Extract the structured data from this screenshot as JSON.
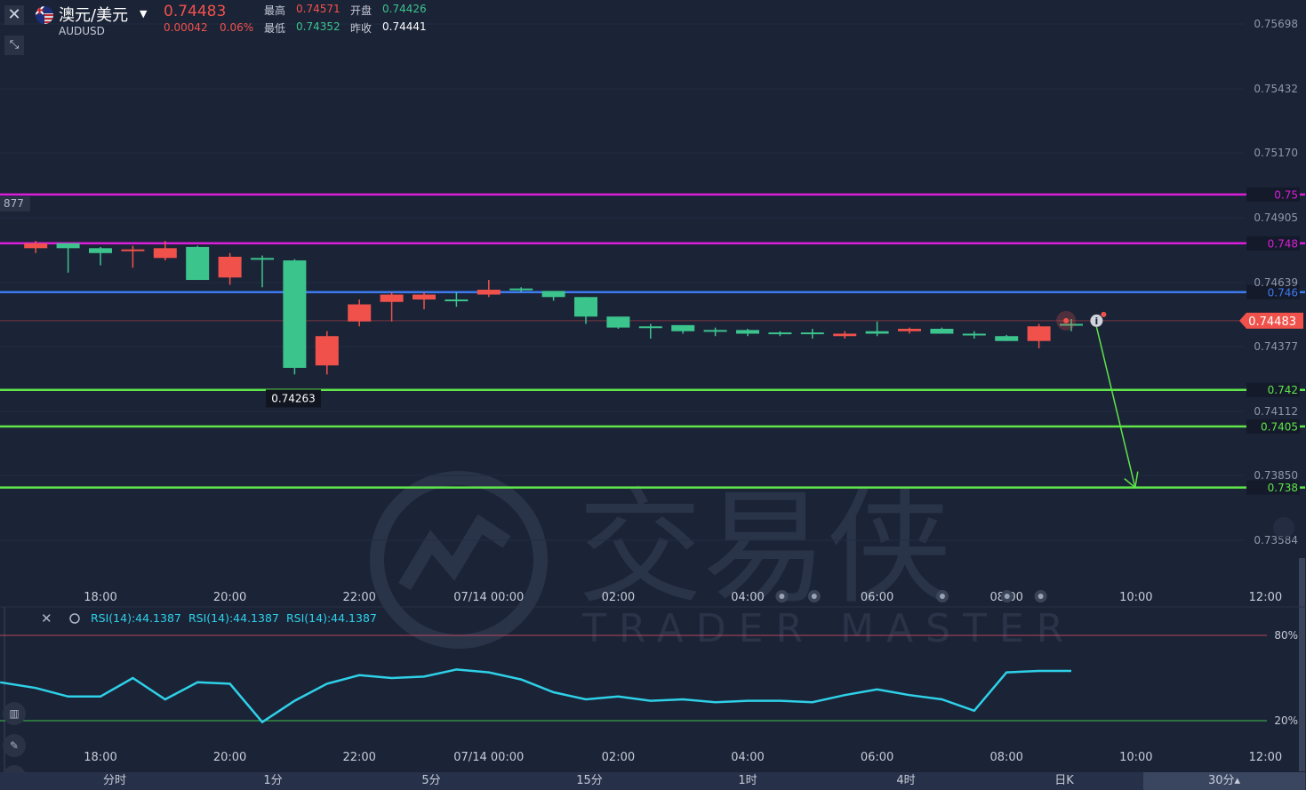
{
  "header": {
    "symbol_name": "澳元/美元",
    "symbol_code": "AUDUSD",
    "last_price": "0.74483",
    "change": "0.00042",
    "change_pct": "0.06%",
    "high_label": "最高",
    "high": "0.74571",
    "open_label": "开盘",
    "open": "0.74426",
    "low_label": "最低",
    "low": "0.74352",
    "prev_close_label": "昨收",
    "prev_close": "0.74441"
  },
  "icons": {
    "close": "close-icon",
    "expand": "expand-icon",
    "flag": "au-us-flag-icon",
    "caret": "caret-down-icon"
  },
  "colors": {
    "background": "#1b2337",
    "up": "#3cc48d",
    "down": "#f0524b",
    "magenta": "#d91fd9",
    "blue": "#3d7bf0",
    "green_line": "#5fe54a",
    "rsi": "#2ed1e8",
    "axis_text": "#8f97a8"
  },
  "chart_data": [
    {
      "type": "candlestick",
      "ylim": [
        0.7345,
        0.7575
      ],
      "y_ticks": [
        "0.75698",
        "0.75432",
        "0.75170",
        "0.74905",
        "0.74639",
        "0.74377",
        "0.74112",
        "0.73850",
        "0.73584"
      ],
      "x_ticks": [
        "18:00",
        "20:00",
        "22:00",
        "07/14 00:00",
        "02:00",
        "04:00",
        "06:00",
        "08:00",
        "10:00",
        "12:00"
      ],
      "x_positions_hours": [
        0,
        2,
        4,
        6,
        8,
        10,
        12,
        14,
        16,
        18
      ],
      "candles": [
        {
          "t": -1.0,
          "o": 0.748,
          "h": 0.7481,
          "l": 0.7476,
          "c": 0.7478
        },
        {
          "t": -0.5,
          "o": 0.7478,
          "h": 0.748,
          "l": 0.7468,
          "c": 0.748
        },
        {
          "t": 0.0,
          "o": 0.7476,
          "h": 0.74785,
          "l": 0.7471,
          "c": 0.7478
        },
        {
          "t": 0.5,
          "o": 0.74775,
          "h": 0.7479,
          "l": 0.747,
          "c": 0.7477
        },
        {
          "t": 1.0,
          "o": 0.7478,
          "h": 0.7481,
          "l": 0.7473,
          "c": 0.7474
        },
        {
          "t": 1.5,
          "o": 0.7465,
          "h": 0.7479,
          "l": 0.7465,
          "c": 0.74785
        },
        {
          "t": 2.0,
          "o": 0.74745,
          "h": 0.7476,
          "l": 0.7463,
          "c": 0.7466
        },
        {
          "t": 2.5,
          "o": 0.7474,
          "h": 0.7475,
          "l": 0.7462,
          "c": 0.7474
        },
        {
          "t": 3.0,
          "o": 0.7429,
          "h": 0.74735,
          "l": 0.74263,
          "c": 0.7473
        },
        {
          "t": 3.5,
          "o": 0.7442,
          "h": 0.7444,
          "l": 0.74263,
          "c": 0.743
        },
        {
          "t": 4.0,
          "o": 0.7455,
          "h": 0.7457,
          "l": 0.7446,
          "c": 0.7448
        },
        {
          "t": 4.5,
          "o": 0.7459,
          "h": 0.746,
          "l": 0.7448,
          "c": 0.7456
        },
        {
          "t": 5.0,
          "o": 0.7459,
          "h": 0.746,
          "l": 0.7453,
          "c": 0.7457
        },
        {
          "t": 5.5,
          "o": 0.7457,
          "h": 0.746,
          "l": 0.7454,
          "c": 0.7457
        },
        {
          "t": 6.0,
          "o": 0.7461,
          "h": 0.7465,
          "l": 0.7458,
          "c": 0.7459
        },
        {
          "t": 6.5,
          "o": 0.7461,
          "h": 0.7462,
          "l": 0.746,
          "c": 0.74615
        },
        {
          "t": 7.0,
          "o": 0.7458,
          "h": 0.74605,
          "l": 0.74565,
          "c": 0.74605
        },
        {
          "t": 7.5,
          "o": 0.745,
          "h": 0.7458,
          "l": 0.7447,
          "c": 0.7458
        },
        {
          "t": 8.0,
          "o": 0.74455,
          "h": 0.745,
          "l": 0.7445,
          "c": 0.745
        },
        {
          "t": 8.5,
          "o": 0.7446,
          "h": 0.7447,
          "l": 0.7441,
          "c": 0.7446
        },
        {
          "t": 9.0,
          "o": 0.7444,
          "h": 0.74465,
          "l": 0.7443,
          "c": 0.74465
        },
        {
          "t": 9.5,
          "o": 0.74445,
          "h": 0.74455,
          "l": 0.7442,
          "c": 0.74445
        },
        {
          "t": 10.0,
          "o": 0.7443,
          "h": 0.7445,
          "l": 0.7442,
          "c": 0.74445
        },
        {
          "t": 10.5,
          "o": 0.74435,
          "h": 0.7444,
          "l": 0.7442,
          "c": 0.74435
        },
        {
          "t": 11.0,
          "o": 0.7443,
          "h": 0.7445,
          "l": 0.7441,
          "c": 0.74435
        },
        {
          "t": 11.5,
          "o": 0.7443,
          "h": 0.7444,
          "l": 0.7441,
          "c": 0.7442
        },
        {
          "t": 12.0,
          "o": 0.7443,
          "h": 0.7448,
          "l": 0.7442,
          "c": 0.7444
        },
        {
          "t": 12.5,
          "o": 0.7445,
          "h": 0.74455,
          "l": 0.7443,
          "c": 0.7444
        },
        {
          "t": 13.0,
          "o": 0.7443,
          "h": 0.74455,
          "l": 0.7443,
          "c": 0.7445
        },
        {
          "t": 13.5,
          "o": 0.74425,
          "h": 0.7444,
          "l": 0.7441,
          "c": 0.7443
        },
        {
          "t": 14.0,
          "o": 0.744,
          "h": 0.74425,
          "l": 0.744,
          "c": 0.7442
        },
        {
          "t": 14.5,
          "o": 0.7446,
          "h": 0.7447,
          "l": 0.7437,
          "c": 0.744
        },
        {
          "t": 15.0,
          "o": 0.7447,
          "h": 0.7449,
          "l": 0.7444,
          "c": 0.7447
        }
      ],
      "current_price": "0.74483",
      "low_label": "0.74263",
      "left_edge_label": "877",
      "horizontal_lines": [
        {
          "price": 0.75,
          "label": "0.75",
          "color": "magenta"
        },
        {
          "price": 0.748,
          "label": "0.748",
          "color": "magenta"
        },
        {
          "price": 0.746,
          "label": "0.746",
          "color": "blue"
        },
        {
          "price": 0.742,
          "label": "0.742",
          "color": "green_line"
        },
        {
          "price": 0.7405,
          "label": "0.7405",
          "color": "green_line"
        },
        {
          "price": 0.738,
          "label": "0.738",
          "color": "green_line"
        }
      ],
      "arrow": {
        "from": {
          "t": 15.5,
          "p": 0.74483
        },
        "to": {
          "t": 16.0,
          "p": 0.738
        }
      }
    },
    {
      "type": "line",
      "title": "RSI(14):44.1387",
      "legend": [
        "RSI(14):44.1387",
        "RSI(14):44.1387",
        "RSI(14):44.1387"
      ],
      "ylim": [
        0,
        100
      ],
      "levels": [
        {
          "value": 80,
          "label": "80%"
        },
        {
          "value": 20,
          "label": "20%"
        }
      ],
      "x_ticks": [
        "18:00",
        "20:00",
        "22:00",
        "07/14 00:00",
        "02:00",
        "04:00",
        "06:00",
        "08:00",
        "10:00",
        "12:00"
      ],
      "x": [
        -1.55,
        -1.0,
        -0.5,
        0.0,
        0.5,
        1.0,
        1.5,
        2.0,
        2.5,
        3.0,
        3.5,
        4.0,
        4.5,
        5.0,
        5.5,
        6.0,
        6.5,
        7.0,
        7.5,
        8.0,
        8.5,
        9.0,
        9.5,
        10.0,
        10.5,
        11.0,
        11.5,
        12.0,
        12.5,
        13.0,
        13.5,
        14.0,
        14.5,
        15.0
      ],
      "values": [
        47,
        43,
        37,
        37,
        50,
        35,
        47,
        46,
        19,
        34,
        46,
        52,
        50,
        51,
        56,
        54,
        49,
        40,
        35,
        37,
        34,
        35,
        33,
        34,
        34,
        33,
        38,
        42,
        38,
        35,
        27,
        54,
        55,
        55
      ]
    }
  ],
  "timeframes": [
    "分时",
    "1分",
    "5分",
    "15分",
    "1时",
    "4时",
    "日K",
    "30分"
  ],
  "active_timeframe": "30分",
  "watermark": {
    "cn": "交易侠",
    "en": "TRADER MASTER"
  }
}
